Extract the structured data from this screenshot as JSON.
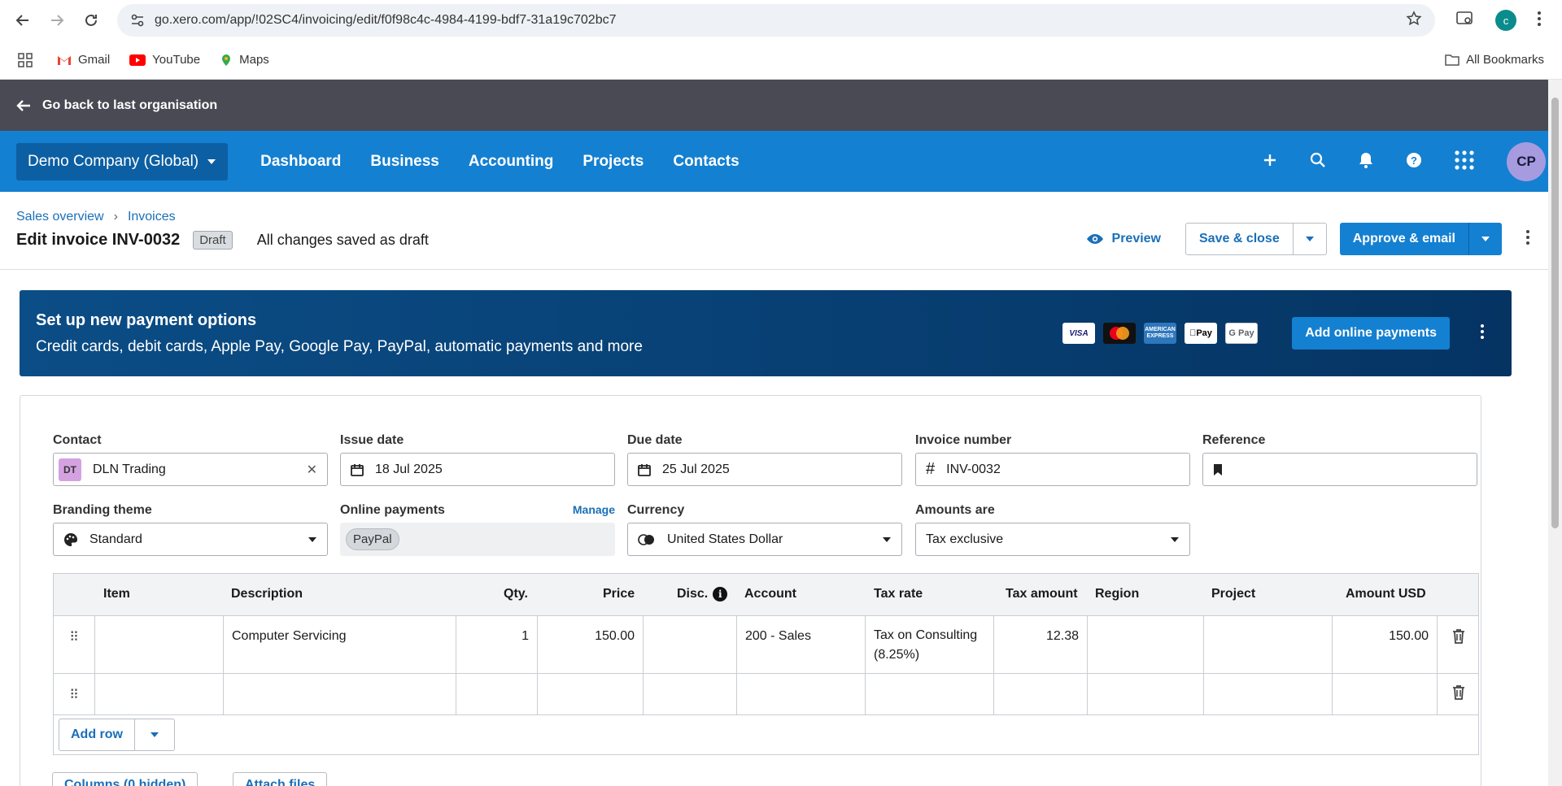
{
  "browser": {
    "url": "go.xero.com/app/!02SC4/invoicing/edit/f0f98c4c-4984-4199-bdf7-31a19c702bc7",
    "profile_initial": "c",
    "bookmarks": [
      "Gmail",
      "YouTube",
      "Maps"
    ],
    "all_bookmarks": "All Bookmarks"
  },
  "org_bar": {
    "back_label": "Go back to last organisation"
  },
  "nav": {
    "org_name": "Demo Company (Global)",
    "items": [
      "Dashboard",
      "Business",
      "Accounting",
      "Projects",
      "Contacts"
    ],
    "avatar": "CP"
  },
  "header": {
    "breadcrumb": [
      "Sales overview",
      "Invoices"
    ],
    "title": "Edit invoice INV-0032",
    "status": "Draft",
    "saved": "All changes saved as draft",
    "preview": "Preview",
    "save_close": "Save & close",
    "approve": "Approve & email"
  },
  "banner": {
    "title": "Set up new payment options",
    "subtitle": "Credit cards, debit cards, Apple Pay, Google Pay, PayPal, automatic payments and more",
    "logos": [
      "VISA",
      "Mastercard",
      "AMEX",
      "Apple Pay",
      "G Pay"
    ],
    "cta": "Add online payments"
  },
  "form": {
    "contact": {
      "label": "Contact",
      "initials": "DT",
      "value": "DLN Trading"
    },
    "issue_date": {
      "label": "Issue date",
      "value": "18 Jul 2025"
    },
    "due_date": {
      "label": "Due date",
      "value": "25 Jul 2025"
    },
    "invoice_number": {
      "label": "Invoice number",
      "value": "INV-0032"
    },
    "reference": {
      "label": "Reference",
      "value": ""
    },
    "branding": {
      "label": "Branding theme",
      "value": "Standard"
    },
    "online_payments": {
      "label": "Online payments",
      "manage": "Manage",
      "value": "PayPal"
    },
    "currency": {
      "label": "Currency",
      "value": "United States Dollar"
    },
    "amounts_are": {
      "label": "Amounts are",
      "value": "Tax exclusive"
    }
  },
  "table": {
    "columns": [
      "Item",
      "Description",
      "Qty.",
      "Price",
      "Disc.",
      "Account",
      "Tax rate",
      "Tax amount",
      "Region",
      "Project",
      "Amount USD"
    ],
    "rows": [
      {
        "item": "",
        "description": "Computer Servicing",
        "qty": "1",
        "price": "150.00",
        "disc": "",
        "account": "200 - Sales",
        "tax_rate": "Tax on Consulting (8.25%)",
        "tax_amount": "12.38",
        "region": "",
        "project": "",
        "amount": "150.00"
      },
      {
        "item": "",
        "description": "",
        "qty": "",
        "price": "",
        "disc": "",
        "account": "",
        "tax_rate": "",
        "tax_amount": "",
        "region": "",
        "project": "",
        "amount": ""
      }
    ],
    "add_row": "Add row"
  },
  "footer": {
    "columns_btn": "Columns (0 hidden)",
    "attach_btn": "Attach files"
  }
}
